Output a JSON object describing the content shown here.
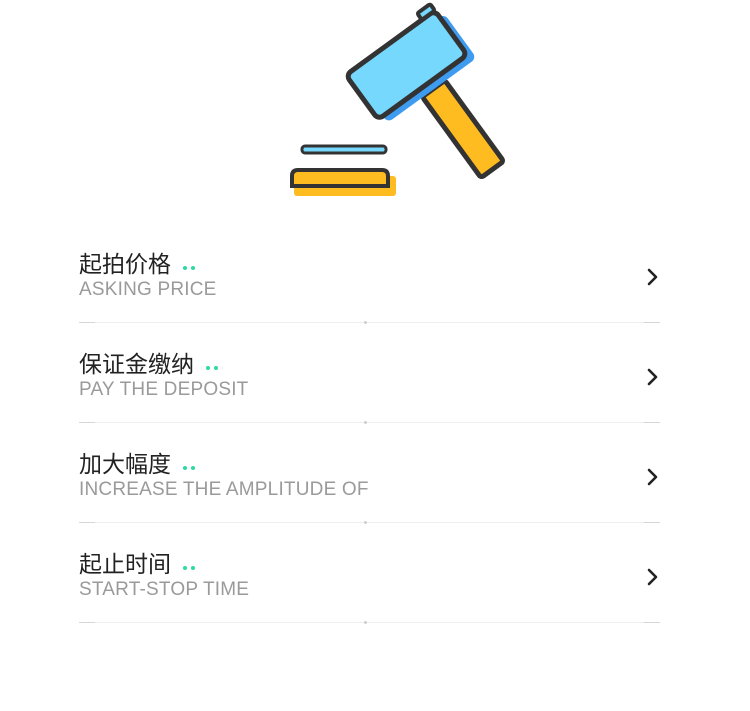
{
  "hero": {
    "icon": "gavel-icon",
    "colors": {
      "head": "#76d8fd",
      "head_shadow": "#3d9cf0",
      "handle": "#ffbc21",
      "outline": "#333333",
      "base": "#ffbc21"
    }
  },
  "settings": {
    "items": [
      {
        "label": "起拍价格",
        "sublabel": "ASKING PRICE"
      },
      {
        "label": "保证金缴纳",
        "sublabel": "PAY THE DEPOSIT"
      },
      {
        "label": "加大幅度",
        "sublabel": "INCREASE THE AMPLITUDE OF"
      },
      {
        "label": "起止时间",
        "sublabel": "START-STOP TIME"
      }
    ],
    "chevron_icon": "chevron-right-icon",
    "accent": "#2edaa4"
  }
}
